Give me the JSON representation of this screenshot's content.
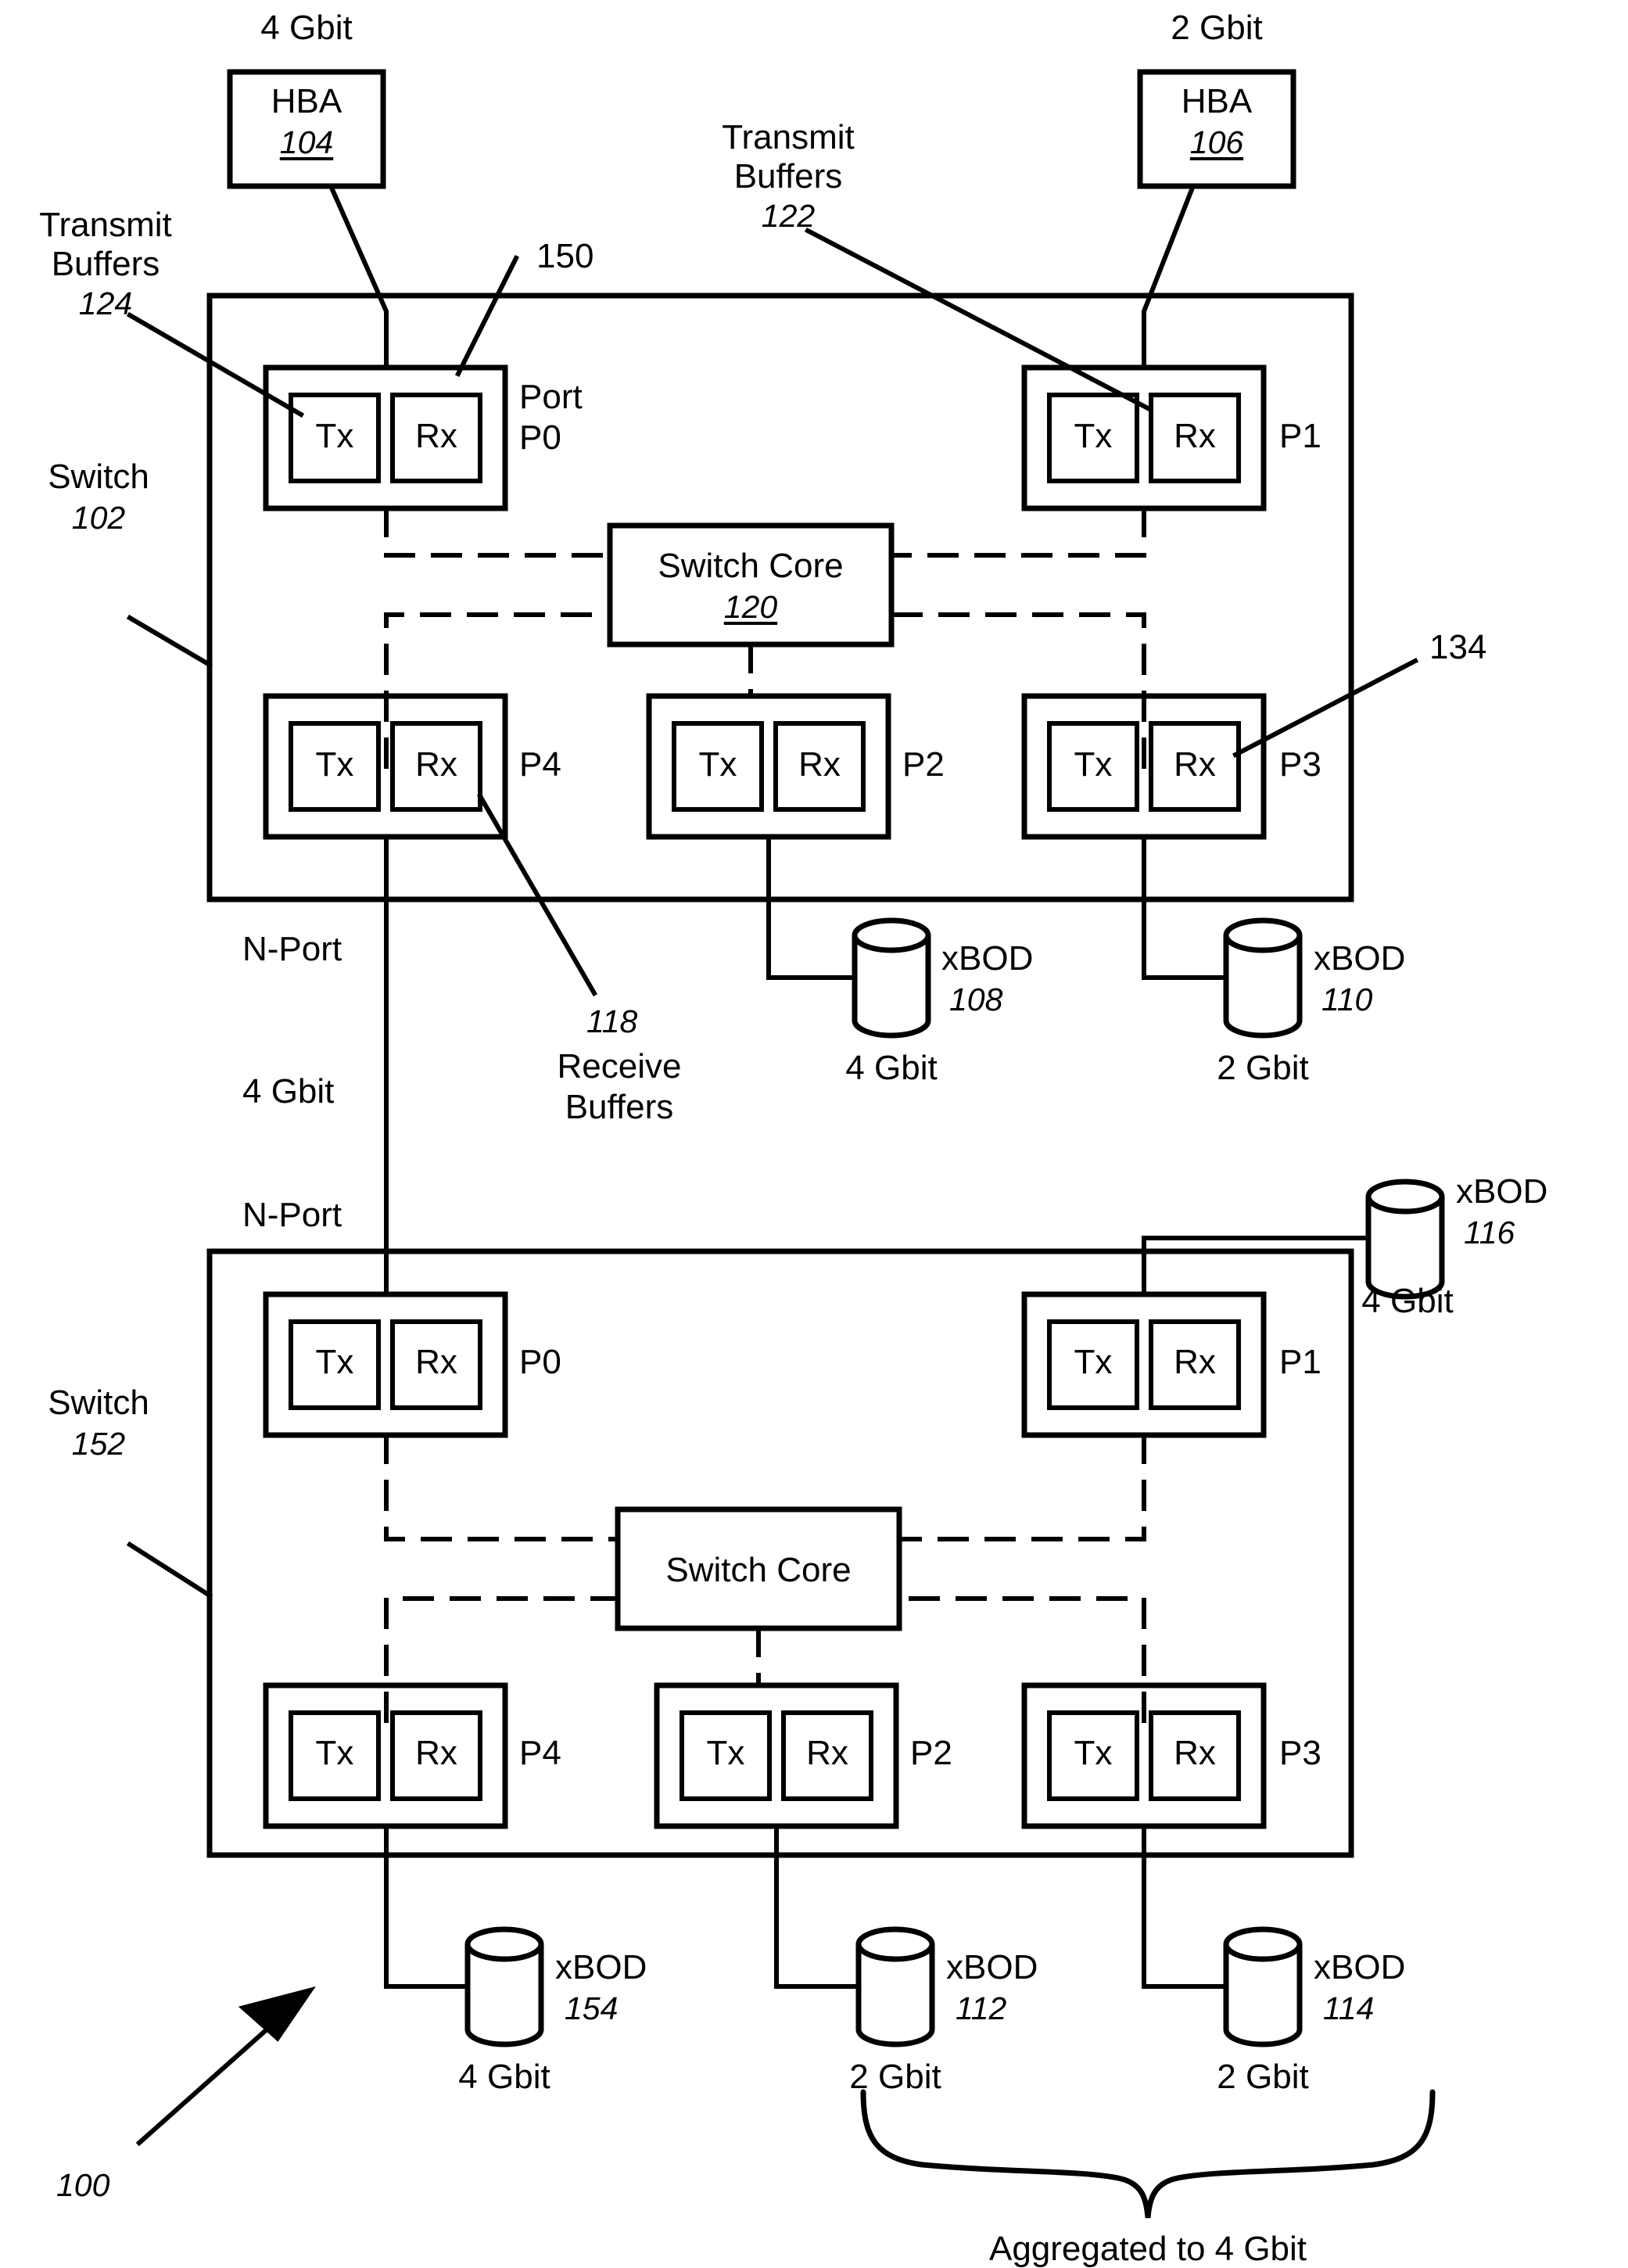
{
  "figure": {
    "reference_number": "100",
    "caption_bottom": "Aggregated to 4 Gbit"
  },
  "hba_top_left": {
    "title": "HBA",
    "ref": "104",
    "speed": "4 Gbit"
  },
  "hba_top_right": {
    "title": "HBA",
    "ref": "106",
    "speed": "2 Gbit"
  },
  "callouts": {
    "transmit_buffers_124": {
      "line1": "Transmit",
      "line2": "Buffers",
      "ref": "124"
    },
    "transmit_buffers_122": {
      "line1": "Transmit",
      "line2": "Buffers",
      "ref": "122"
    },
    "receive_buffers_118": {
      "ref": "118",
      "line1": "Receive",
      "line2": "Buffers"
    },
    "callout_150": {
      "ref": "150"
    },
    "callout_134": {
      "ref": "134"
    }
  },
  "switch_top": {
    "label": "Switch",
    "ref": "102",
    "core": {
      "title": "Switch Core",
      "ref": "120"
    },
    "ports": [
      {
        "id": "p0",
        "name_line1": "Port",
        "name_line2": "P0",
        "tx": "Tx",
        "rx": "Rx"
      },
      {
        "id": "p1",
        "name_line1": "P1",
        "name_line2": "",
        "tx": "Tx",
        "rx": "Rx"
      },
      {
        "id": "p4",
        "name_line1": "P4",
        "name_line2": "",
        "tx": "Tx",
        "rx": "Rx"
      },
      {
        "id": "p2",
        "name_line1": "P2",
        "name_line2": "",
        "tx": "Tx",
        "rx": "Rx"
      },
      {
        "id": "p3",
        "name_line1": "P3",
        "name_line2": "",
        "tx": "Tx",
        "rx": "Rx"
      }
    ]
  },
  "switch_bottom": {
    "label": "Switch",
    "ref": "152",
    "core": {
      "title": "Switch Core",
      "ref": ""
    },
    "ports": [
      {
        "id": "p0",
        "name_line1": "P0",
        "tx": "Tx",
        "rx": "Rx"
      },
      {
        "id": "p1",
        "name_line1": "P1",
        "tx": "Tx",
        "rx": "Rx"
      },
      {
        "id": "p4",
        "name_line1": "P4",
        "tx": "Tx",
        "rx": "Rx"
      },
      {
        "id": "p2",
        "name_line1": "P2",
        "tx": "Tx",
        "rx": "Rx"
      },
      {
        "id": "p3",
        "name_line1": "P3",
        "tx": "Tx",
        "rx": "Rx"
      }
    ]
  },
  "link_labels": {
    "nport_upper": "N-Port",
    "nport_lower": "N-Port",
    "isl_speed": "4 Gbit"
  },
  "storage": [
    {
      "id": "xbod_108",
      "name": "xBOD",
      "ref": "108",
      "speed": "4 Gbit"
    },
    {
      "id": "xbod_110",
      "name": "xBOD",
      "ref": "110",
      "speed": "2 Gbit"
    },
    {
      "id": "xbod_116",
      "name": "xBOD",
      "ref": "116",
      "speed": "4 Gbit"
    },
    {
      "id": "xbod_154",
      "name": "xBOD",
      "ref": "154",
      "speed": "4 Gbit"
    },
    {
      "id": "xbod_112",
      "name": "xBOD",
      "ref": "112",
      "speed": "2 Gbit"
    },
    {
      "id": "xbod_114",
      "name": "xBOD",
      "ref": "114",
      "speed": "2 Gbit"
    }
  ],
  "colors": {
    "ink": "#000000",
    "paper": "#ffffff"
  }
}
